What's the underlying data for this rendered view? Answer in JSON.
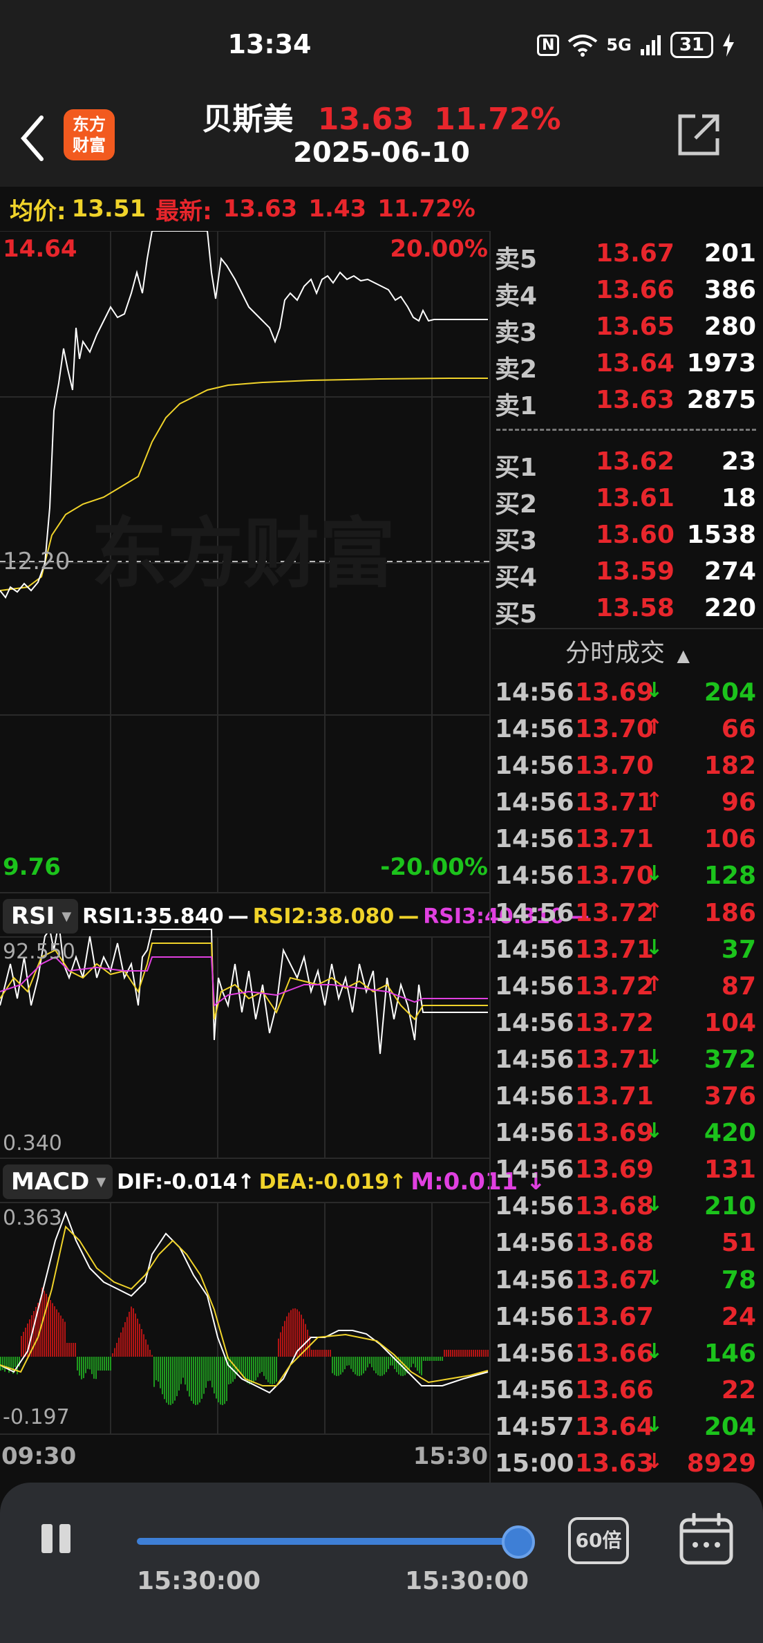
{
  "status": {
    "time": "13:34",
    "nfc": "N",
    "signal": "5G",
    "battery": "31"
  },
  "header": {
    "logo_line1": "东方",
    "logo_line2": "财富",
    "name": "贝斯美",
    "price": "13.63",
    "pct": "11.72%",
    "date": "2025-06-10"
  },
  "info": {
    "avg_label": "均价:",
    "avg_value": "13.51",
    "latest_label": "最新:",
    "latest_price": "13.63",
    "latest_change": "1.43",
    "latest_pct": "11.72%"
  },
  "chart": {
    "price_high": "14.64",
    "pct_high": "20.00%",
    "price_mid": "12.20",
    "price_low": "9.76",
    "pct_low": "-20.00%",
    "watermark": "东方财富",
    "rsi": {
      "name": "RSI",
      "rsi1": "RSI1:35.840",
      "rsi2": "RSI2:38.080",
      "rsi3": "RSI3:40.310",
      "top": "92.550",
      "bottom": "0.340"
    },
    "macd": {
      "name": "MACD",
      "dif": "DIF:-0.014↑",
      "dea": "DEA:-0.019↑",
      "m": "M:0.011 ↓",
      "top": "0.363",
      "bottom": "-0.197"
    },
    "time_start": "09:30",
    "time_end": "15:30",
    "colors": {
      "up": "#e8262c",
      "down": "#1cc31c",
      "price_line": "#ffffff",
      "avg_line": "#f0d32a",
      "rsi3": "#e040e0"
    }
  },
  "order_book": {
    "asks": [
      {
        "label": "卖5",
        "price": "13.67",
        "volume": "201"
      },
      {
        "label": "卖4",
        "price": "13.66",
        "volume": "386"
      },
      {
        "label": "卖3",
        "price": "13.65",
        "volume": "280"
      },
      {
        "label": "卖2",
        "price": "13.64",
        "volume": "1973"
      },
      {
        "label": "卖1",
        "price": "13.63",
        "volume": "2875"
      }
    ],
    "bids": [
      {
        "label": "买1",
        "price": "13.62",
        "volume": "23"
      },
      {
        "label": "买2",
        "price": "13.61",
        "volume": "18"
      },
      {
        "label": "买3",
        "price": "13.60",
        "volume": "1538"
      },
      {
        "label": "买4",
        "price": "13.59",
        "volume": "274"
      },
      {
        "label": "买5",
        "price": "13.58",
        "volume": "220"
      }
    ]
  },
  "trades_title": "分时成交",
  "trades_title_arrow": "▲",
  "trades": [
    {
      "time": "14:56",
      "price": "13.69",
      "arrow": "↓",
      "volume": "204",
      "dir": "down"
    },
    {
      "time": "14:56",
      "price": "13.70",
      "arrow": "↑",
      "volume": "66",
      "dir": "up"
    },
    {
      "time": "14:56",
      "price": "13.70",
      "arrow": "",
      "volume": "182",
      "dir": "up"
    },
    {
      "time": "14:56",
      "price": "13.71",
      "arrow": "↑",
      "volume": "96",
      "dir": "up"
    },
    {
      "time": "14:56",
      "price": "13.71",
      "arrow": "",
      "volume": "106",
      "dir": "up"
    },
    {
      "time": "14:56",
      "price": "13.70",
      "arrow": "↓",
      "volume": "128",
      "dir": "down"
    },
    {
      "time": "14:56",
      "price": "13.72",
      "arrow": "↑",
      "volume": "186",
      "dir": "up"
    },
    {
      "time": "14:56",
      "price": "13.71",
      "arrow": "↓",
      "volume": "37",
      "dir": "down"
    },
    {
      "time": "14:56",
      "price": "13.72",
      "arrow": "↑",
      "volume": "87",
      "dir": "up"
    },
    {
      "time": "14:56",
      "price": "13.72",
      "arrow": "",
      "volume": "104",
      "dir": "up"
    },
    {
      "time": "14:56",
      "price": "13.71",
      "arrow": "↓",
      "volume": "372",
      "dir": "down"
    },
    {
      "time": "14:56",
      "price": "13.71",
      "arrow": "",
      "volume": "376",
      "dir": "up"
    },
    {
      "time": "14:56",
      "price": "13.69",
      "arrow": "↓",
      "volume": "420",
      "dir": "down"
    },
    {
      "time": "14:56",
      "price": "13.69",
      "arrow": "",
      "volume": "131",
      "dir": "up"
    },
    {
      "time": "14:56",
      "price": "13.68",
      "arrow": "↓",
      "volume": "210",
      "dir": "down"
    },
    {
      "time": "14:56",
      "price": "13.68",
      "arrow": "",
      "volume": "51",
      "dir": "up"
    },
    {
      "time": "14:56",
      "price": "13.67",
      "arrow": "↓",
      "volume": "78",
      "dir": "down"
    },
    {
      "time": "14:56",
      "price": "13.67",
      "arrow": "",
      "volume": "24",
      "dir": "up"
    },
    {
      "time": "14:56",
      "price": "13.66",
      "arrow": "↓",
      "volume": "146",
      "dir": "down"
    },
    {
      "time": "14:56",
      "price": "13.66",
      "arrow": "",
      "volume": "22",
      "dir": "up"
    },
    {
      "time": "14:57",
      "price": "13.64",
      "arrow": "↓",
      "volume": "204",
      "dir": "down"
    },
    {
      "time": "15:00",
      "price": "13.63",
      "arrow": "↓",
      "volume": "8929",
      "dir": "up"
    }
  ],
  "player": {
    "progress": 1.0,
    "start_time": "15:30:00",
    "end_time": "15:30:00",
    "speed": "60倍"
  }
}
